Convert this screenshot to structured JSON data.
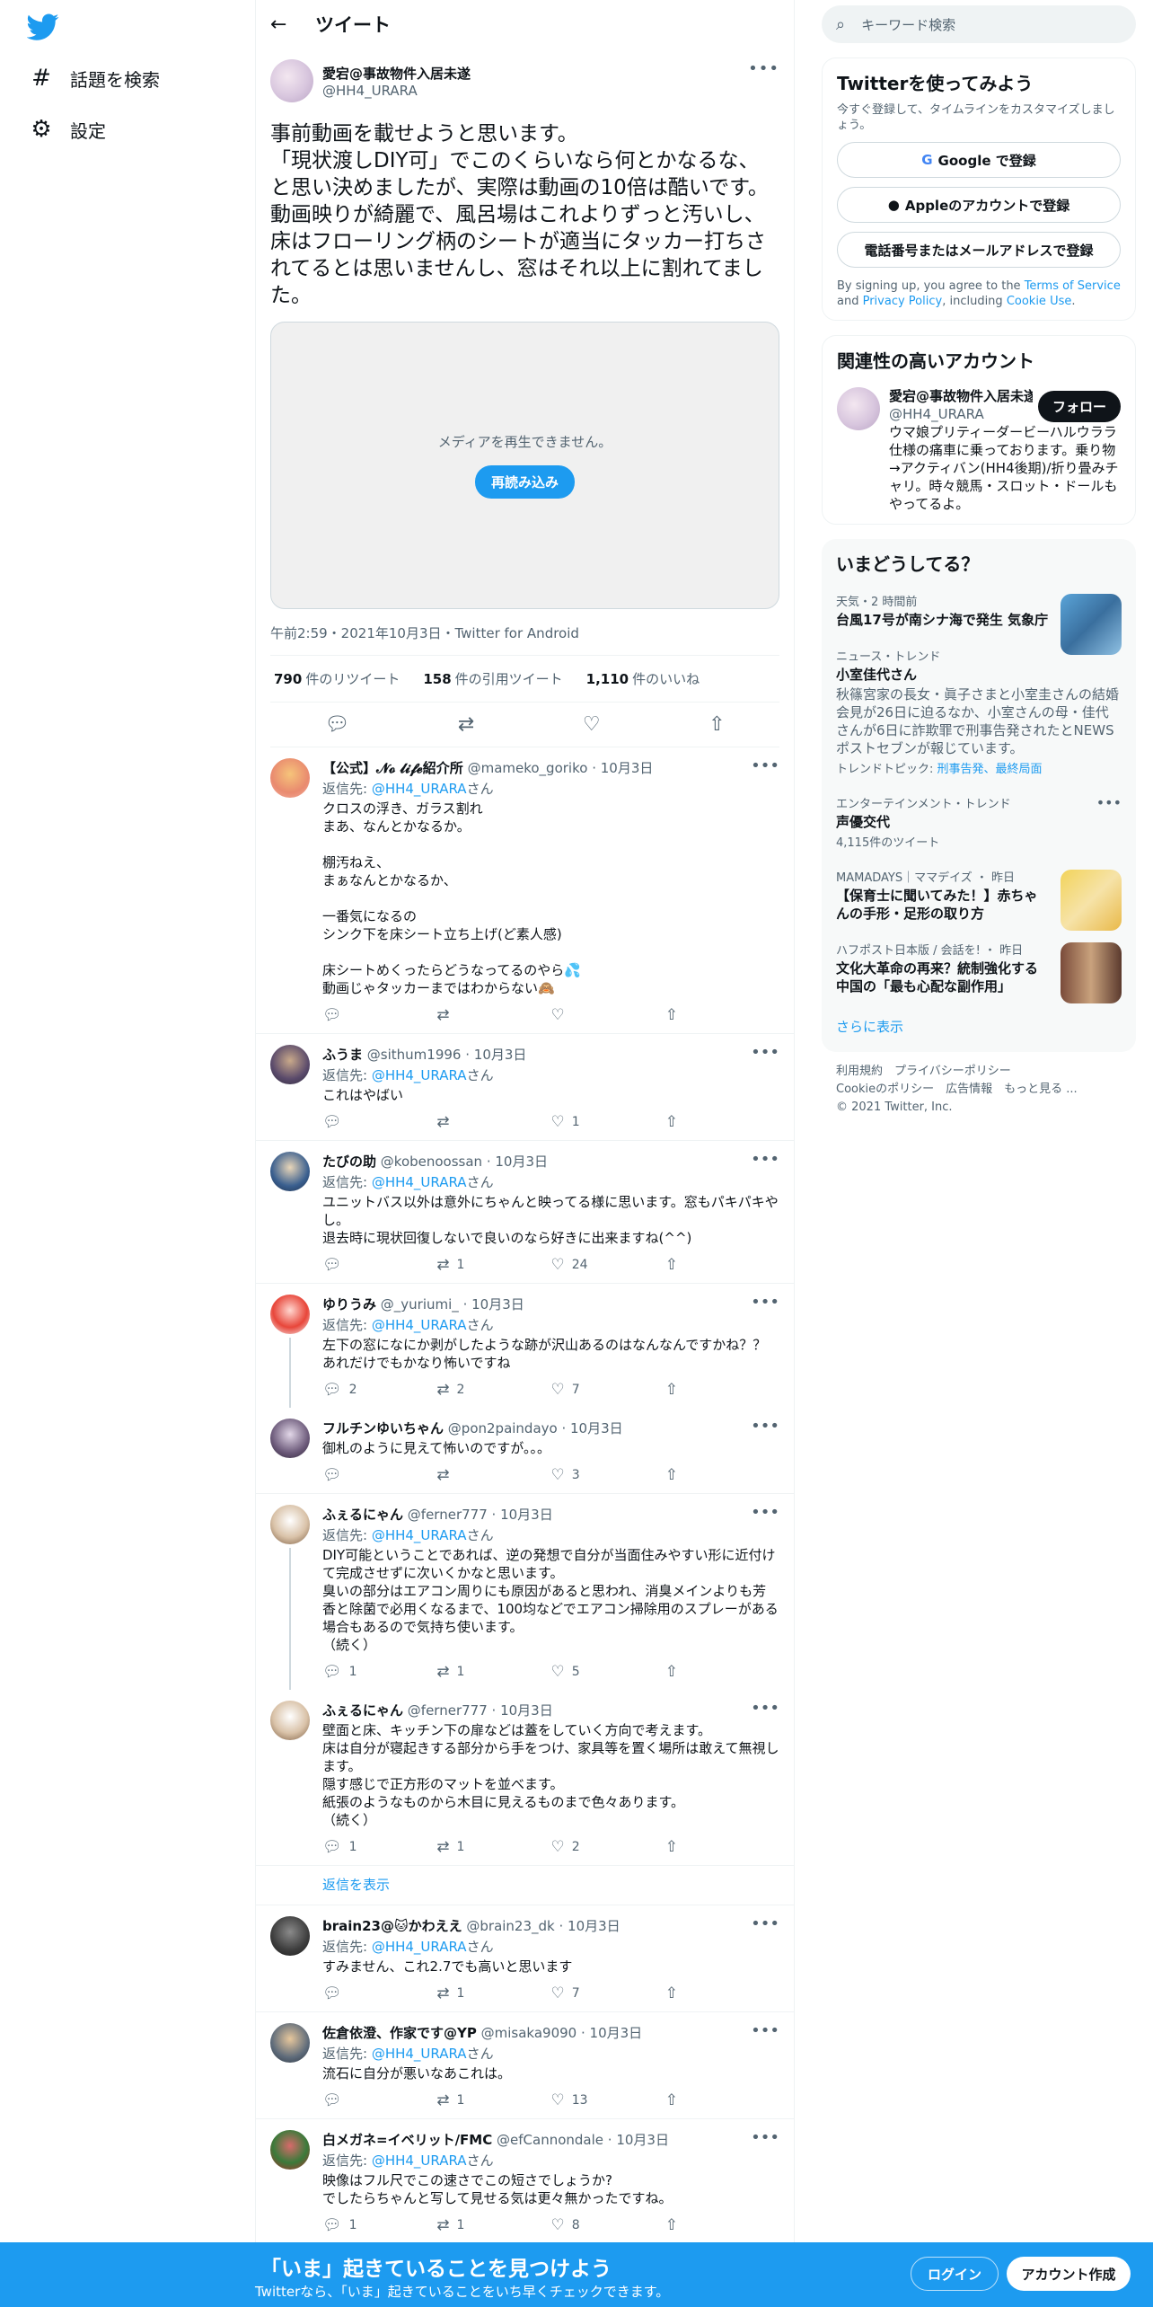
{
  "nav": {
    "explore": "話題を検索",
    "settings": "設定"
  },
  "header": {
    "title": "ツイート"
  },
  "tweet": {
    "name": "愛宕@事故物件入居未遂",
    "handle": "@HH4_URARA",
    "text": "事前動画を載せようと思います。\n「現状渡しDIY可」でこのくらいなら何とかなるな、と思い決めましたが、実際は動画の10倍は酷いです。動画映りが綺麗で、風呂場はこれよりずっと汚いし、床はフローリング柄のシートが適当にタッカー打ちされてるとは思いませんし、窓はそれ以上に割れてました。",
    "media_message": "メディアを再生できません。",
    "reload_label": "再読み込み",
    "meta": "午前2:59・2021年10月3日・Twitter for Android",
    "retweets": "790",
    "retweets_label": "件のリツイート",
    "quotes": "158",
    "quotes_label": "件の引用ツイート",
    "likes": "1,110",
    "likes_label": "件のいいね"
  },
  "replies": [
    {
      "name": "【公式】𝓝𝓸 𝓵𝓲𝓯𝓮紹介所",
      "handle": "@mameko_goriko",
      "date": "10月3日",
      "reply_to_prefix": "返信先: ",
      "reply_to": "@HH4_URARA",
      "reply_to_suffix": "さん",
      "text": "クロスの浮き、ガラス割れ\nまあ、なんとかなるか。\n\n棚汚ねえ、\nまぁなんとかなるか、\n\n一番気になるの\nシンク下を床シート立ち上げ(ど素人感)\n\n床シートめくったらどうなってるのやら💦\n動画じゃタッカーまではわからない🙈",
      "replies": "",
      "retweets": "",
      "likes": ""
    },
    {
      "name": "ふうま",
      "handle": "@sithum1996",
      "date": "10月3日",
      "reply_to_prefix": "返信先: ",
      "reply_to": "@HH4_URARA",
      "reply_to_suffix": "さん",
      "text": "これはやばい",
      "replies": "",
      "retweets": "",
      "likes": "1"
    },
    {
      "name": "たびの助",
      "handle": "@kobenoossan",
      "date": "10月3日",
      "reply_to_prefix": "返信先: ",
      "reply_to": "@HH4_URARA",
      "reply_to_suffix": "さん",
      "text": "ユニットバス以外は意外にちゃんと映ってる様に思います。窓もパキパキやし。\n退去時に現状回復しないで良いのなら好きに出来ますね(^^)",
      "replies": "",
      "retweets": "1",
      "likes": "24"
    },
    {
      "name": "ゆりうみ",
      "handle": "@_yuriumi_",
      "date": "10月3日",
      "reply_to_prefix": "返信先: ",
      "reply_to": "@HH4_URARA",
      "reply_to_suffix": "さん",
      "text": "左下の窓になにか剥がしたような跡が沢山あるのはなんなんですかね？？あれだけでもかなり怖いですね",
      "replies": "2",
      "retweets": "2",
      "likes": "7"
    },
    {
      "name": "フルチンゆいちゃん",
      "handle": "@pon2paindayo",
      "date": "10月3日",
      "reply_to_prefix": "",
      "reply_to": "",
      "reply_to_suffix": "",
      "text": "御札のように見えて怖いのですが。。。",
      "replies": "",
      "retweets": "",
      "likes": "3"
    },
    {
      "name": "ふぇるにゃん",
      "handle": "@ferner777",
      "date": "10月3日",
      "reply_to_prefix": "返信先: ",
      "reply_to": "@HH4_URARA",
      "reply_to_suffix": "さん",
      "text": "DIY可能ということであれば、逆の発想で自分が当面住みやすい形に近付けて完成させずに次いくかなと思います。\n臭いの部分はエアコン周りにも原因があると思われ、消臭メインよりも芳香と除菌で必用くなるまで、100均などでエアコン掃除用のスプレーがある場合もあるので気持ち使います。\n（続く）",
      "replies": "1",
      "retweets": "1",
      "likes": "5"
    },
    {
      "name": "ふぇるにゃん",
      "handle": "@ferner777",
      "date": "10月3日",
      "reply_to_prefix": "",
      "reply_to": "",
      "reply_to_suffix": "",
      "text": "壁面と床、キッチン下の扉などは蓋をしていく方向で考えます。\n床は自分が寝起きする部分から手をつけ、家具等を置く場所は敢えて無視します。\n隠す感じで正方形のマットを並べます。\n紙張のようなものから木目に見えるものまで色々あります。\n（続く）",
      "replies": "1",
      "retweets": "1",
      "likes": "2"
    },
    {
      "name": "brain23@🐱かわええ",
      "handle": "@brain23_dk",
      "date": "10月3日",
      "reply_to_prefix": "返信先: ",
      "reply_to": "@HH4_URARA",
      "reply_to_suffix": "さん",
      "text": "すみません、これ2.7でも高いと思います",
      "replies": "",
      "retweets": "1",
      "likes": "7"
    },
    {
      "name": "佐倉依澄、作家です@YP",
      "handle": "@misaka9090",
      "date": "10月3日",
      "reply_to_prefix": "返信先: ",
      "reply_to": "@HH4_URARA",
      "reply_to_suffix": "さん",
      "text": "流石に自分が悪いなあこれは。",
      "replies": "",
      "retweets": "1",
      "likes": "13"
    },
    {
      "name": "白メガネ=イベリット/FMC",
      "handle": "@efCannondale",
      "date": "10月3日",
      "reply_to_prefix": "返信先: ",
      "reply_to": "@HH4_URARA",
      "reply_to_suffix": "さん",
      "text": "映像はフル尺でこの速さでこの短さでしょうか?\nでしたらちゃんと写して見せる気は更々無かったですね。",
      "replies": "1",
      "retweets": "1",
      "likes": "8"
    }
  ],
  "show_replies": "返信を表示",
  "search": {
    "placeholder": "キーワード検索"
  },
  "signup": {
    "title": "Twitterを使ってみよう",
    "subtitle": "今すぐ登録して、タイムラインをカスタマイズしましょう。",
    "google": "Google で登録",
    "apple": "Appleのアカウントで登録",
    "phone": "電話番号またはメールアドレスで登録",
    "terms_1": "By signing up, you agree to the ",
    "terms_link1": "Terms of Service",
    "terms_2": " and ",
    "terms_link2": "Privacy Policy",
    "terms_3": ", including ",
    "terms_link3": "Cookie Use",
    "terms_4": "."
  },
  "related": {
    "title": "関連性の高いアカウント",
    "name": "愛宕@事故物件入居未遂",
    "handle": "@HH4_URARA",
    "bio": "ウマ娘プリティーダービーハルウララ仕様の痛車に乗っております。乗り物→アクティバン(HH4後期)/折り畳みチャリ。時々競馬・スロット・ドールもやってるよ。",
    "follow": "フォロー"
  },
  "trends": {
    "title": "いまどうしてる？",
    "items": [
      {
        "category": "天気・2 時間前",
        "name": "台風17号が南シナ海で発生 気象庁",
        "desc": "",
        "count": ""
      },
      {
        "category": "ニュース・トレンド",
        "name": "小室佳代さん",
        "desc": "秋篠宮家の長女・眞子さまと小室圭さんの結婚会見が26日に迫るなか、小室さんの母・佳代さんが6日に詐欺罪で刑事告発されたとNEWSポストセブンが報じています。",
        "topics_prefix": "トレンドトピック: ",
        "topics": "刑事告発、最終局面"
      },
      {
        "category": "エンターテインメント・トレンド",
        "name": "声優交代",
        "desc": "",
        "count": "4,115件のツイート"
      },
      {
        "category": "MAMADAYS｜ママデイズ ・ 昨日",
        "name": "【保育士に聞いてみた！】赤ちゃんの手形・足形の取り方",
        "desc": "",
        "count": ""
      },
      {
        "category": "ハフポスト日本版 / 会話を! ・ 昨日",
        "name": "文化大革命の再来？統制強化する中国の「最も心配な副作用」",
        "desc": "",
        "count": ""
      }
    ],
    "show_more": "さらに表示"
  },
  "footer": {
    "line1": "利用規約　プライバシーポリシー",
    "line2": "Cookieのポリシー　広告情報　もっと見る ...",
    "line3": "© 2021 Twitter, Inc."
  },
  "bottombar": {
    "title": "「いま」起きていることを見つけよう",
    "subtitle": "Twitterなら、「いま」起きていることをいち早くチェックできます。",
    "login": "ログイン",
    "signup": "アカウント作成"
  },
  "colors": {
    "accent": "#1d9bf0",
    "text": "#0f1419",
    "muted": "#536471"
  }
}
